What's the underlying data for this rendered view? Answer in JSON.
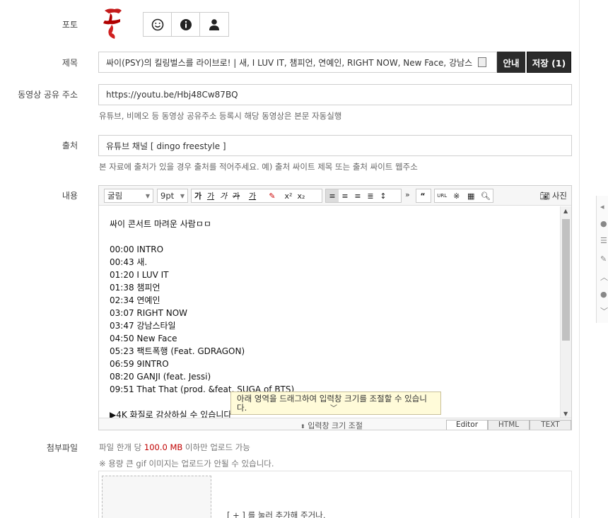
{
  "labels": {
    "photo": "포토",
    "title": "제목",
    "video_url": "동영상 공유 주소",
    "source": "출처",
    "content": "내용",
    "attachment": "첨부파일"
  },
  "photo_icons": [
    "smile-icon",
    "info-icon",
    "user-icon"
  ],
  "title": {
    "value": "싸이(PSY)의 킬링벌스를 라이브로! | 새, I LUV IT, 챔피언, 연예인, RIGHT NOW, New Face, 강남스",
    "guide_button": "안내",
    "save_button": "저장 (1)"
  },
  "video_url": {
    "value": "https://youtu.be/Hbj48Cw87BQ",
    "help": "유튜브, 비메오 등 동영상 공유주소 등록시 해당 동영상은 본문 자동실행"
  },
  "source": {
    "value": "유튜브 채널 [ dingo freestyle ]",
    "help": "본 자료에 출처가 있을 경우 출처를 적어주세요. 예) 출처 싸이트 제목 또는 출처 싸이트 웹주소"
  },
  "editor": {
    "font_family": "굴림",
    "font_size": "9pt",
    "format_buttons": [
      "가",
      "가",
      "가",
      "가",
      "가"
    ],
    "photo_button": "사진",
    "lines": [
      "싸이 콘서트 마려운 사람ㅁㅁ",
      "",
      "00:00 INTRO",
      "00:43 새.",
      "01:20 I LUV IT",
      "01:38 챔피언",
      "02:34 연예인",
      "03:07 RIGHT NOW",
      "03:47 강남스타일",
      "04:50 New Face",
      "05:23 팩트폭행 (Feat. GDRAGON)",
      "06:59 9INTRO",
      "08:20 GANJI (feat. Jessi)",
      "09:51 That That (prod. &feat. SUGA of BTS)",
      "",
      "▶4K 화질로 감상하실 수 있습니다"
    ],
    "tooltip": "아래 영역을 드래그하여 입력창 크기를 조절할 수 있습니다.",
    "resize_label": "입력창 크기 조절",
    "modes": [
      "Editor",
      "HTML",
      "TEXT"
    ],
    "active_mode": "Editor"
  },
  "attachment": {
    "limit_prefix": "파일 한개 당 ",
    "limit_size": "100.0 MB",
    "limit_suffix": " 이하만 업로드 가능",
    "gif_note": "※ 용량 큰 gif 이미지는 업로드가 안될 수 있습니다.",
    "hint": "[ + ] 를 눌러 추가해 주거나,",
    "size_color": "#c00000"
  }
}
